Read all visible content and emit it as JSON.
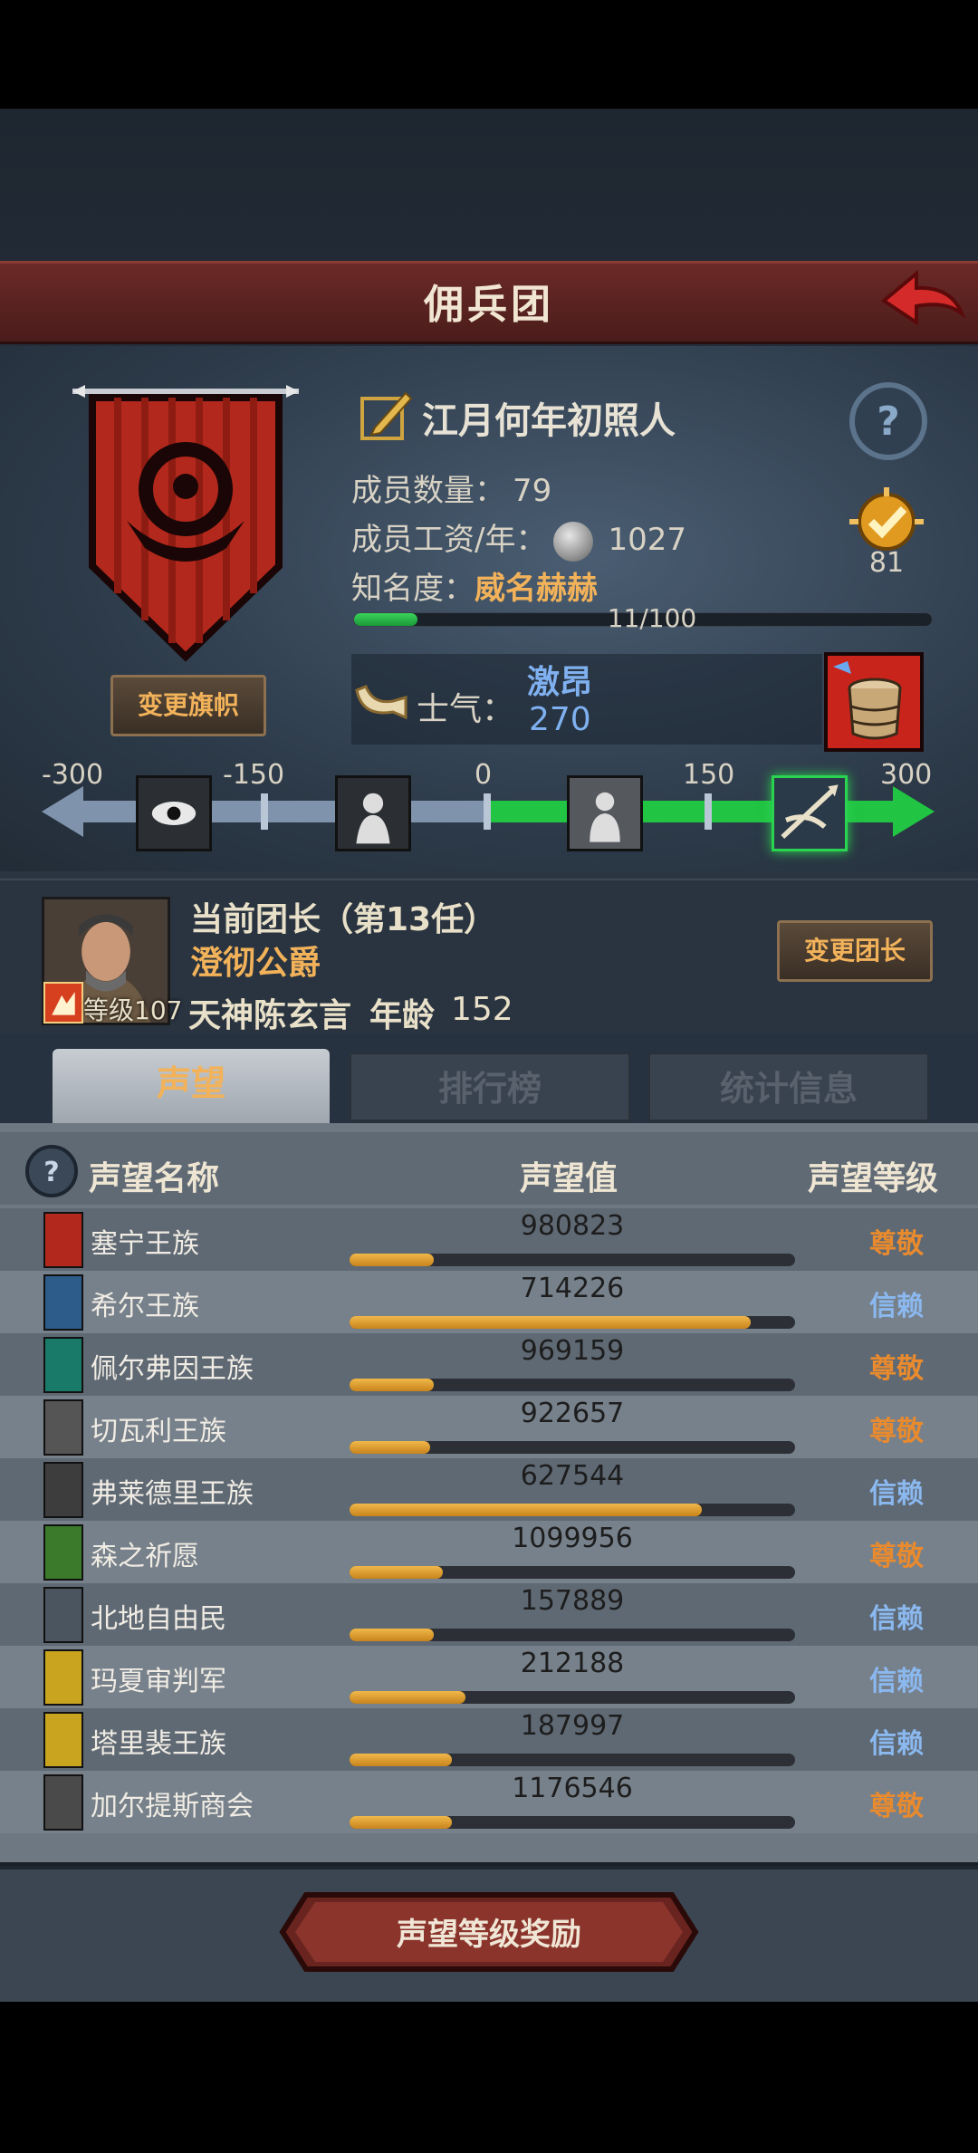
{
  "header": {
    "title": "佣兵团"
  },
  "team": {
    "name": "江月何年初照人",
    "members_label": "成员数量：",
    "members_value": "79",
    "salary_label": "成员工资/年：",
    "salary_value": "1027",
    "fame_label": "知名度：",
    "fame_value": "威名赫赫",
    "fame_progress": "11/100",
    "fame_fraction": 0.11,
    "badge_count": "81",
    "change_flag_label": "变更旗帜"
  },
  "morale": {
    "label": "士气：",
    "state": "激昂",
    "value": "270",
    "scale_ticks": [
      "-300",
      "-150",
      "0",
      "150",
      "300"
    ]
  },
  "leader": {
    "title": "当前团长（第13任）",
    "noble_title": "澄彻公爵",
    "level": "等级107",
    "name": "天神陈玄言",
    "age_label": "年龄",
    "age_value": "152",
    "change_leader_label": "变更团长"
  },
  "tabs": [
    "声望",
    "排行榜",
    "统计信息"
  ],
  "table": {
    "headers": [
      "声望名称",
      "声望值",
      "声望等级"
    ],
    "rows": [
      {
        "name": "塞宁王族",
        "value": "980823",
        "level": "尊敬",
        "fill": 0.19,
        "color": "#b3281c"
      },
      {
        "name": "希尔王族",
        "value": "714226",
        "level": "信赖",
        "fill": 0.9,
        "color": "#2d5c8a"
      },
      {
        "name": "佩尔弗因王族",
        "value": "969159",
        "level": "尊敬",
        "fill": 0.19,
        "color": "#1a7a6a"
      },
      {
        "name": "切瓦利王族",
        "value": "922657",
        "level": "尊敬",
        "fill": 0.18,
        "color": "#555"
      },
      {
        "name": "弗莱德里王族",
        "value": "627544",
        "level": "信赖",
        "fill": 0.79,
        "color": "#3d3d3d"
      },
      {
        "name": "森之祈愿",
        "value": "1099956",
        "level": "尊敬",
        "fill": 0.21,
        "color": "#3a7a2a"
      },
      {
        "name": "北地自由民",
        "value": "157889",
        "level": "信赖",
        "fill": 0.19,
        "color": "#4a5560"
      },
      {
        "name": "玛夏审判军",
        "value": "212188",
        "level": "信赖",
        "fill": 0.26,
        "color": "#c9a51f"
      },
      {
        "name": "塔里裴王族",
        "value": "187997",
        "level": "信赖",
        "fill": 0.23,
        "color": "#c9a51f"
      },
      {
        "name": "加尔提斯商会",
        "value": "1176546",
        "level": "尊敬",
        "fill": 0.23,
        "color": "#4a4a4a"
      }
    ]
  },
  "footer": {
    "reward_label": "声望等级奖励"
  },
  "colors": {
    "accent": "#f2b25a",
    "trust": "#8ab8ef",
    "respect": "#e88a2e",
    "green": "#21c443"
  },
  "icons": [
    "back-arrow-icon",
    "help-icon",
    "edit-name-icon",
    "coin-icon",
    "check-badge-icon",
    "horn-icon",
    "barrel-icon"
  ]
}
